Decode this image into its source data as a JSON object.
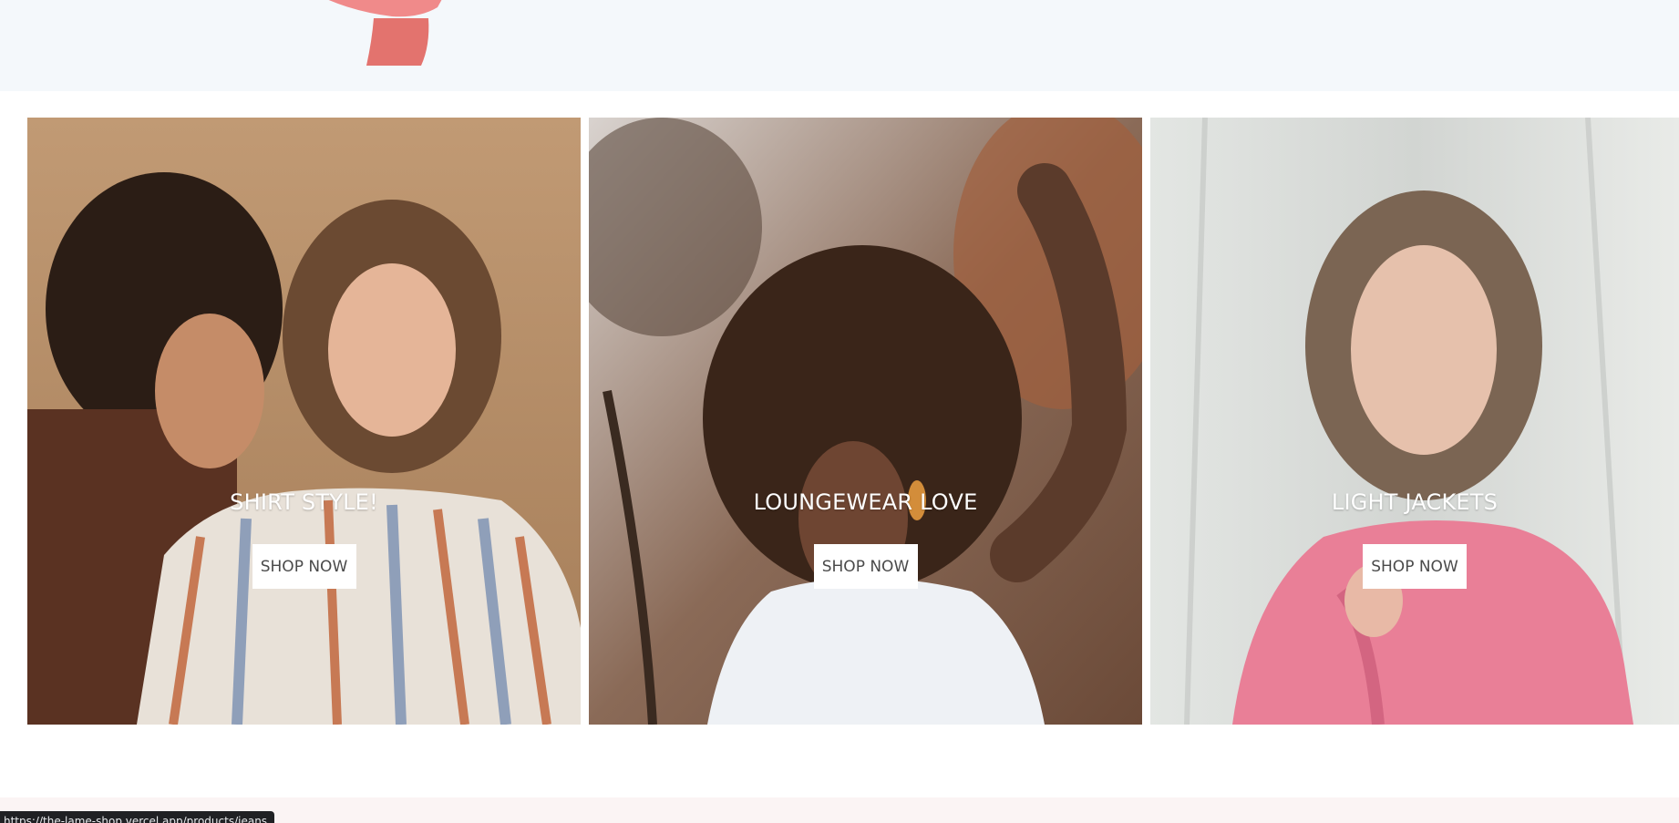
{
  "cards": [
    {
      "title": "SHIRT STYLE!",
      "button": "SHOP NOW"
    },
    {
      "title": "LOUNGEWEAR LOVE",
      "button": "SHOP NOW"
    },
    {
      "title": "LIGHT JACKETS",
      "button": "SHOP NOW"
    }
  ],
  "status_bar": {
    "url": "https://the-lame-shop.vercel.app/products/jeans"
  },
  "colors": {
    "top_band": "#f4f8fb",
    "bottom_band": "#fbf4f4",
    "button_bg": "#ffffff",
    "button_text": "#4a4a4a",
    "title_text": "#ffffff"
  }
}
